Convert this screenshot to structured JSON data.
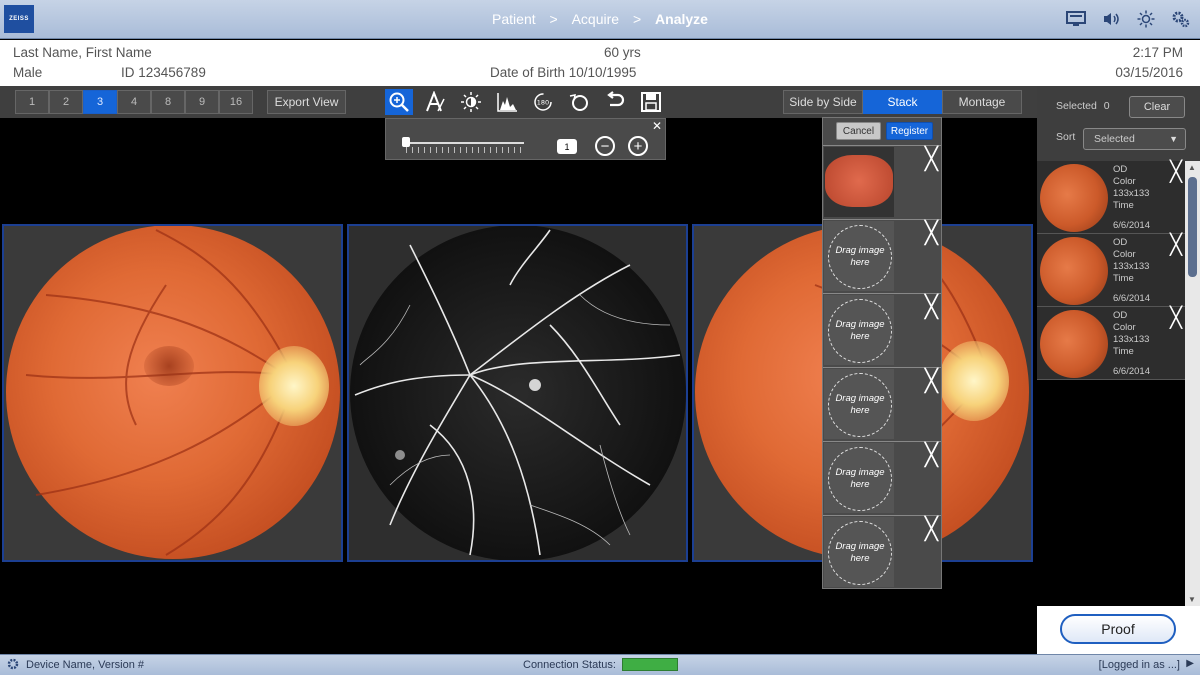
{
  "topbar": {
    "logo_text": "ZEISS",
    "breadcrumbs": [
      "Patient",
      "Acquire",
      "Analyze"
    ],
    "separator": ">",
    "icons": [
      "display-icon",
      "speaker-icon",
      "brightness-icon",
      "settings-icon"
    ]
  },
  "patient": {
    "name": "Last Name, First Name",
    "sex": "Male",
    "id": "ID 123456789",
    "age": "60 yrs",
    "dob": "Date of Birth 10/10/1995",
    "time": "2:17 PM",
    "date": "03/15/2016"
  },
  "toolbar": {
    "layouts": [
      "1",
      "2",
      "3",
      "4",
      "8",
      "9",
      "16"
    ],
    "selected_layout": "3",
    "export_label": "Export View",
    "tools": [
      "zoom-icon",
      "annotate-icon",
      "brightness-icon",
      "histogram-icon",
      "rotate-180-icon",
      "rotate-icon",
      "undo-icon",
      "save-icon"
    ],
    "views": [
      "Side by Side",
      "Stack",
      "Montage"
    ],
    "selected_view": "Stack"
  },
  "zoom": {
    "value": "1",
    "close": "✕",
    "minus": "−",
    "plus": "+"
  },
  "register": {
    "cancel_label": "Cancel",
    "register_label": "Register",
    "drag_text": "Drag image here",
    "slot_close": "╳"
  },
  "right_panel": {
    "selected_label": "Selected",
    "selected_count": "0",
    "clear_label": "Clear",
    "sort_label": "Sort",
    "sort_value": "Selected",
    "thumbnails": [
      {
        "eye": "OD",
        "type": "Color",
        "size": "133x133",
        "time": "Time",
        "date": "6/6/2014"
      },
      {
        "eye": "OD",
        "type": "Color",
        "size": "133x133",
        "time": "Time",
        "date": "6/6/2014"
      },
      {
        "eye": "OD",
        "type": "Color",
        "size": "133x133",
        "time": "Time",
        "date": "6/6/2014"
      }
    ],
    "proof_label": "Proof"
  },
  "statusbar": {
    "device": "Device Name, Version #",
    "connection_label": "Connection Status:",
    "connection_color": "#3fae44",
    "logged_in": "[Logged in as ...]"
  },
  "colors": {
    "accent": "#1565d8",
    "frame_border": "#1c3f92"
  }
}
